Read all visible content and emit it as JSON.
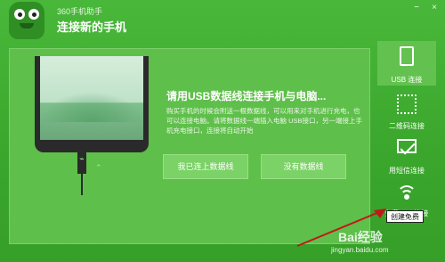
{
  "app": {
    "name": "360手机助手",
    "window_title": "连接新的手机"
  },
  "window_controls": [
    "−",
    "×"
  ],
  "main": {
    "headline": "请用USB数据线连接手机与电脑...",
    "description": "购买手机的时候会附送一根数据线，可以用来对手机进行充电，也可以连接电脑。请将数据线一端插入电脑 USB接口，另一端接上手机充电接口，连接将自动开始",
    "buttons": {
      "connected": "我已连上数据线",
      "no_cable": "没有数据线"
    },
    "phone_usb_glyph": "⌁",
    "spark_glyph": "⌃"
  },
  "sidebar": {
    "items": [
      {
        "label": "USB 连接",
        "icon": "usb-icon",
        "active": true
      },
      {
        "label": "二维码连接",
        "icon": "qr-code-icon",
        "active": false
      },
      {
        "label": "用短信连接",
        "icon": "sms-icon",
        "active": false
      },
      {
        "label": "免费WIFI连接",
        "icon": "wifi-icon",
        "active": false
      }
    ]
  },
  "tooltip": "创建免费",
  "watermark": {
    "text": "Bai经验",
    "url": "jingyan.baidu.com"
  },
  "colors": {
    "background": "#3aa62c",
    "card": "#5fbf4b",
    "button": "#7bd266",
    "annotation_arrow": "#c01818"
  }
}
